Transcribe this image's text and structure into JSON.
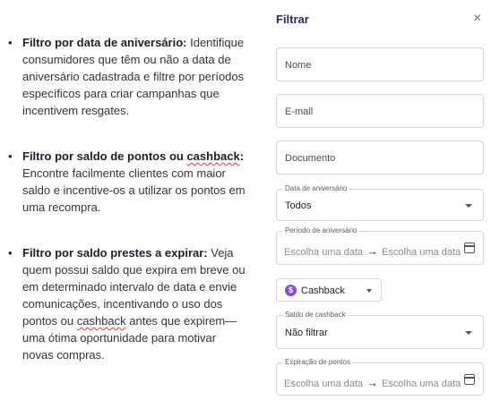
{
  "bullets": [
    {
      "head": "Filtro por data de aniversário:",
      "body": " Identifique consumidores que têm ou não a data de aniversário cadastrada e filtre por períodos específicos para criar campanhas que incentivem resgates."
    },
    {
      "head_a": "Filtro por saldo de pontos ou ",
      "head_b": "cashback",
      "head_c": ":",
      "body": " Encontre facilmente clientes com maior saldo e incentive-os a utilizar os pontos em uma recompra."
    },
    {
      "head": "Filtro por saldo prestes a expirar:",
      "body_a": " Veja quem possui saldo que expira em breve ou em determinado intervalo de data e envie comunicações, incentivando o uso dos pontos ou ",
      "body_b": "cashback",
      "body_c": " antes que expirem—uma ótima oportunidade para motivar novas compras."
    }
  ],
  "panel": {
    "title": "Filtrar",
    "close_icon": "×",
    "name_placeholder": "Nome",
    "email_placeholder": "E-mail",
    "document_placeholder": "Documento",
    "birthday_legend": "Data de aniversário",
    "birthday_value": "Todos",
    "period_legend": "Período de aniversário",
    "period_start": "Escolha uma data",
    "period_end": "Escolha uma data",
    "cashback_chip": "Cashback",
    "cashback_coin": "$",
    "balance_legend": "Saldo de cashback",
    "balance_value": "Não filtrar",
    "expiration_legend": "Expiração de pontos",
    "expiration_start": "Escolha uma data",
    "expiration_end": "Escolha uma data",
    "arrow": "→"
  }
}
